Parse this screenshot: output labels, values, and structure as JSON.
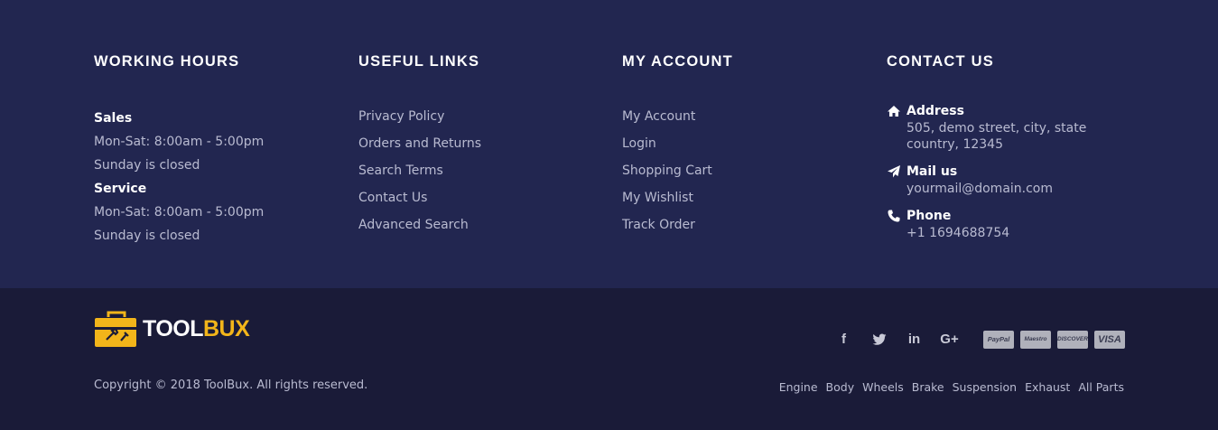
{
  "working_hours": {
    "title": "WORKING HOURS",
    "sales_label": "Sales",
    "sales_time": "Mon-Sat: 8:00am - 5:00pm",
    "sales_closed": "Sunday is closed",
    "service_label": "Service",
    "service_time": "Mon-Sat: 8:00am - 5:00pm",
    "service_closed": "Sunday is closed"
  },
  "useful_links": {
    "title": "USEFUL LINKS",
    "items": [
      "Privacy Policy",
      "Orders and Returns",
      "Search Terms",
      "Contact Us",
      "Advanced Search"
    ]
  },
  "my_account": {
    "title": "MY ACCOUNT",
    "items": [
      "My Account",
      "Login",
      "Shopping Cart",
      "My Wishlist",
      "Track Order"
    ]
  },
  "contact_us": {
    "title": "CONTACT US",
    "address_label": "Address",
    "address_value": "505, demo street, city, state country, 12345",
    "mail_label": "Mail us",
    "mail_value": "yourmail@domain.com",
    "phone_label": "Phone",
    "phone_value": "+1 1694688754",
    "icons": [
      "home-icon",
      "paper-plane-icon",
      "phone-icon"
    ]
  },
  "brand": {
    "logo_part1": "TOOL",
    "logo_part2": "BUX",
    "copyright": "Copyright © 2018 ToolBux. All rights reserved.",
    "accent_color": "#f2b51a"
  },
  "social": {
    "icons": [
      "facebook-icon",
      "twitter-icon",
      "linkedin-icon",
      "google-plus-icon"
    ],
    "glyphs": [
      "f",
      "t",
      "in",
      "G+"
    ]
  },
  "payments": [
    "PayPal",
    "Maestro",
    "DISCOVER",
    "VISA"
  ],
  "categories": [
    "Engine",
    "Body",
    "Wheels",
    "Brake",
    "Suspension",
    "Exhaust",
    "All Parts"
  ],
  "colors": {
    "top_background": "#222650",
    "bottom_background": "#1a1b38",
    "text_muted": "#b9bbd1",
    "heading": "#ffffff"
  }
}
